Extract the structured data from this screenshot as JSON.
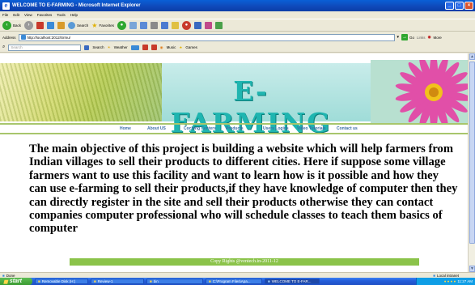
{
  "window": {
    "title": "WELCOME TO E-FARMING - Microsoft Internet Explorer"
  },
  "menu": [
    "File",
    "Edit",
    "View",
    "Favorites",
    "Tools",
    "Help"
  ],
  "toolbar": {
    "back_label": "Back",
    "search_label": "Search",
    "favorites_label": "Favorites"
  },
  "address": {
    "label": "Address",
    "url": "http://localhost:2012/Srmu/",
    "go_label": "Go",
    "links_label": "Links",
    "more_label": "More"
  },
  "searchbar": {
    "placeholder": "Search",
    "search_label": "Search",
    "weather_label": "Weather",
    "music_label": "Music",
    "games_label": "Games"
  },
  "page": {
    "banner_title": "E-FARMING",
    "nav": [
      "Home",
      "About US",
      "Coching Centers",
      "Products",
      "Users Logins",
      "Video Tutorials",
      "Contact us"
    ],
    "main_text": "The main objective of this project is building a website which will help farmers from Indian villages to sell their products to different cities. Here if suppose some village farmers want to use this facility and want to learn how is it possible and how they can use e-farming to sell their products,if they have knowledge of computer then they can directly register in the site and sell their products otherwise they can contact companies computer professional who will schedule classes to teach them basics of computer",
    "footer": "Copy Rights @ventech.in-2011-12"
  },
  "status": {
    "left": "Done",
    "zone": "Local intranet"
  },
  "taskbar": {
    "start": "start",
    "tasks": [
      "Removable Disk (H:)",
      "Review-1",
      "bin",
      "C:\\Program Files\\Apa...",
      "WELCOME TO E-FAR..."
    ],
    "clock": "11:27 AM"
  },
  "colors": {
    "brand_teal": "#1fb5b0",
    "nav_blue": "#3a6ea5",
    "footer_green": "#8bc34a"
  }
}
